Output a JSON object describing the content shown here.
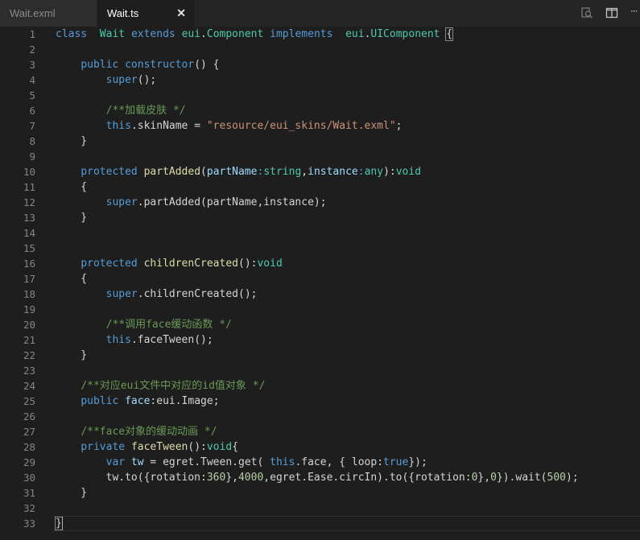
{
  "tabs": [
    {
      "label": "Wait.exml",
      "active": false
    },
    {
      "label": "Wait.ts",
      "active": true
    }
  ],
  "tab_close_glyph": "✕",
  "toolbar_icons": [
    "search-icon",
    "split-editor-icon",
    "more-icon"
  ],
  "toolbar_more_glyph": "···",
  "colors": {
    "keyword": "#569cd6",
    "type": "#4ec9b0",
    "function": "#dcdcaa",
    "string": "#ce9178",
    "comment": "#6a9955",
    "number": "#b5cea8",
    "property": "#9cdcfe",
    "text": "#d4d4d4",
    "background": "#1e1e1e"
  },
  "code_lines": [
    [
      [
        "k",
        "class"
      ],
      [
        "",
        "  "
      ],
      [
        "t",
        "Wait"
      ],
      [
        "",
        " "
      ],
      [
        "k",
        "extends"
      ],
      [
        "",
        " "
      ],
      [
        "t",
        "eui"
      ],
      [
        "",
        "."
      ],
      [
        "t",
        "Component"
      ],
      [
        "",
        " "
      ],
      [
        "k",
        "implements"
      ],
      [
        "",
        "  "
      ],
      [
        "t",
        "eui"
      ],
      [
        "",
        "."
      ],
      [
        "t",
        "UIComponent"
      ],
      [
        "",
        " "
      ],
      [
        "b",
        "{"
      ]
    ],
    [],
    [
      [
        "",
        "    "
      ],
      [
        "k",
        "public"
      ],
      [
        "",
        " "
      ],
      [
        "k",
        "constructor"
      ],
      [
        "",
        "() {"
      ]
    ],
    [
      [
        "",
        "        "
      ],
      [
        "k",
        "super"
      ],
      [
        "",
        "();"
      ]
    ],
    [],
    [
      [
        "",
        "        "
      ],
      [
        "c",
        "/**加载皮肤 */"
      ]
    ],
    [
      [
        "",
        "        "
      ],
      [
        "k",
        "this"
      ],
      [
        "",
        ".skinName = "
      ],
      [
        "s",
        "\"resource/eui_skins/Wait.exml\""
      ],
      [
        "",
        ";"
      ]
    ],
    [
      [
        "",
        "    }"
      ]
    ],
    [],
    [
      [
        "",
        "    "
      ],
      [
        "k",
        "protected"
      ],
      [
        "",
        " "
      ],
      [
        "f",
        "partAdded"
      ],
      [
        "",
        "("
      ],
      [
        "p",
        "partName"
      ],
      [
        "k",
        ":"
      ],
      [
        "t",
        "string"
      ],
      [
        "",
        ","
      ],
      [
        "p",
        "instance"
      ],
      [
        "k",
        ":"
      ],
      [
        "t",
        "any"
      ],
      [
        "",
        "):"
      ],
      [
        "t",
        "void"
      ]
    ],
    [
      [
        "",
        "    {"
      ]
    ],
    [
      [
        "",
        "        "
      ],
      [
        "k",
        "super"
      ],
      [
        "",
        ".partAdded(partName,instance);"
      ]
    ],
    [
      [
        "",
        "    }"
      ]
    ],
    [],
    [],
    [
      [
        "",
        "    "
      ],
      [
        "k",
        "protected"
      ],
      [
        "",
        " "
      ],
      [
        "f",
        "childrenCreated"
      ],
      [
        "",
        "():"
      ],
      [
        "t",
        "void"
      ]
    ],
    [
      [
        "",
        "    {"
      ]
    ],
    [
      [
        "",
        "        "
      ],
      [
        "k",
        "super"
      ],
      [
        "",
        ".childrenCreated();"
      ]
    ],
    [],
    [
      [
        "",
        "        "
      ],
      [
        "c",
        "/**调用face缓动函数 */"
      ]
    ],
    [
      [
        "",
        "        "
      ],
      [
        "k",
        "this"
      ],
      [
        "",
        ".faceTween();"
      ]
    ],
    [
      [
        "",
        "    }"
      ]
    ],
    [],
    [
      [
        "",
        "    "
      ],
      [
        "c",
        "/**对应eui文件中对应的id值对象 */"
      ]
    ],
    [
      [
        "",
        "    "
      ],
      [
        "k",
        "public"
      ],
      [
        "",
        " "
      ],
      [
        "p",
        "face"
      ],
      [
        "",
        ":eui.Image;"
      ]
    ],
    [],
    [
      [
        "",
        "    "
      ],
      [
        "c",
        "/**face对象的缓动动画 */"
      ]
    ],
    [
      [
        "",
        "    "
      ],
      [
        "k",
        "private"
      ],
      [
        "",
        " "
      ],
      [
        "f",
        "faceTween"
      ],
      [
        "",
        "():"
      ],
      [
        "t",
        "void"
      ],
      [
        "",
        "{"
      ]
    ],
    [
      [
        "",
        "        "
      ],
      [
        "k",
        "var"
      ],
      [
        "",
        " "
      ],
      [
        "p",
        "tw"
      ],
      [
        "",
        " = egret.Tween.get( "
      ],
      [
        "k",
        "this"
      ],
      [
        "",
        ".face, { loop:"
      ],
      [
        "k",
        "true"
      ],
      [
        "",
        "});"
      ]
    ],
    [
      [
        "",
        "        tw.to({rotation:"
      ],
      [
        "n",
        "360"
      ],
      [
        "",
        "},"
      ],
      [
        "n",
        "4000"
      ],
      [
        "",
        ",egret.Ease.circIn).to({rotation:"
      ],
      [
        "n",
        "0"
      ],
      [
        "",
        "},"
      ],
      [
        "n",
        "0"
      ],
      [
        "",
        "}).wait("
      ],
      [
        "n",
        "500"
      ],
      [
        "",
        ");"
      ]
    ],
    [
      [
        "",
        "    }"
      ]
    ],
    [],
    [
      [
        "b",
        "}"
      ]
    ]
  ],
  "line_numbers": [
    "1",
    "2",
    "3",
    "4",
    "5",
    "6",
    "7",
    "8",
    "9",
    "10",
    "11",
    "12",
    "13",
    "14",
    "15",
    "16",
    "17",
    "18",
    "19",
    "20",
    "21",
    "22",
    "23",
    "24",
    "25",
    "26",
    "27",
    "28",
    "29",
    "30",
    "31",
    "32",
    "33"
  ]
}
